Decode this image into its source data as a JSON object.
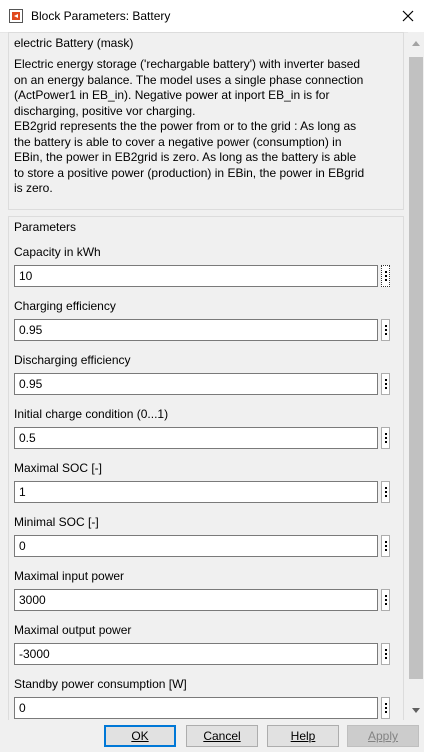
{
  "window": {
    "title": "Block Parameters: Battery"
  },
  "mask": {
    "title": "electric Battery (mask)",
    "description_lines": [
      "Electric energy storage ('rechargable battery') with inverter based",
      "on an energy balance. The model uses a single phase connection",
      "(ActPower1 in EB_in). Negative power at inport EB_in is for",
      "discharging, positive vor charging.",
      "EB2grid represents the the power from or to the grid : As long as",
      "the battery is able to cover a negative power (consumption) in",
      "EBin, the power in EB2grid is zero. As long as the battery is able",
      "to store a positive power (production) in EBin, the power in EBgrid",
      "is zero."
    ]
  },
  "parameters": {
    "title": "Parameters",
    "items": [
      {
        "label": "Capacity in kWh",
        "value": "10"
      },
      {
        "label": "Charging efficiency",
        "value": "0.95"
      },
      {
        "label": "Discharging efficiency",
        "value": "0.95"
      },
      {
        "label": "Initial charge condition (0...1)",
        "value": "0.5"
      },
      {
        "label": "Maximal SOC [-]",
        "value": "1"
      },
      {
        "label": "Minimal SOC [-]",
        "value": "0"
      },
      {
        "label": "Maximal input power",
        "value": "3000"
      },
      {
        "label": "Maximal output power",
        "value": "-3000"
      },
      {
        "label": "Standby power consumption [W]",
        "value": "0"
      }
    ]
  },
  "buttons": {
    "ok": "OK",
    "cancel": "Cancel",
    "help": "Help",
    "apply": "Apply"
  }
}
